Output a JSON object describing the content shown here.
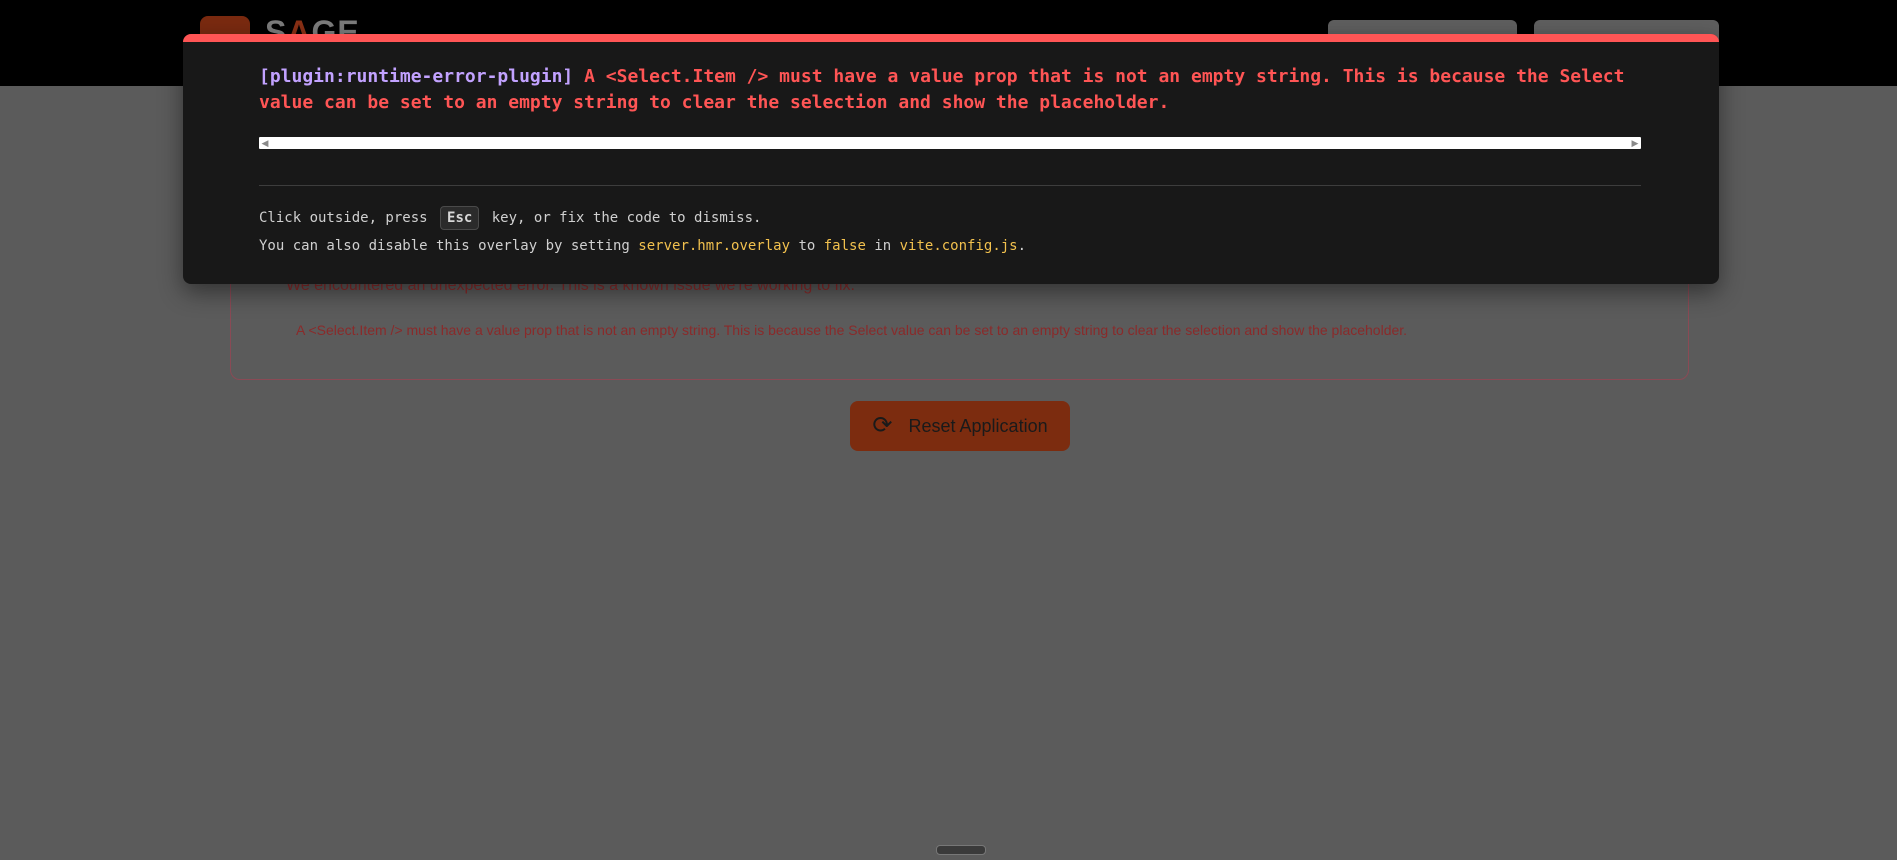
{
  "app": {
    "logo_text_pre": "S",
    "logo_text_accent": "A",
    "logo_text_post": "GE"
  },
  "error_page": {
    "intro": "We encountered an unexpected error. This is a known issue we're working to fix.",
    "detail": "A <Select.Item /> must have a value prop that is not an empty string. This is because the Select value can be set to an empty string to clear the selection and show the placeholder.",
    "reset_label": "Reset Application",
    "reset_icon": "refresh-icon"
  },
  "overlay": {
    "plugin": "[plugin:runtime-error-plugin]",
    "message": " A <Select.Item /> must have a value prop that is not an empty string. This is because the Select value can be set to an empty string to clear the selection and show the placeholder.",
    "tip1_pre": "Click outside, press ",
    "tip1_key": "Esc",
    "tip1_post": " key, or fix the code to dismiss.",
    "tip2_pre": "You can also disable this overlay by setting ",
    "tip2_code1": "server.hmr.overlay",
    "tip2_mid1": " to ",
    "tip2_code2": "false",
    "tip2_mid2": " in ",
    "tip2_code3": "vite.config.js",
    "tip2_post": ".",
    "accent_color": "#ff5555",
    "plugin_color": "#c2a2ff",
    "code_color": "#f2c14e"
  }
}
